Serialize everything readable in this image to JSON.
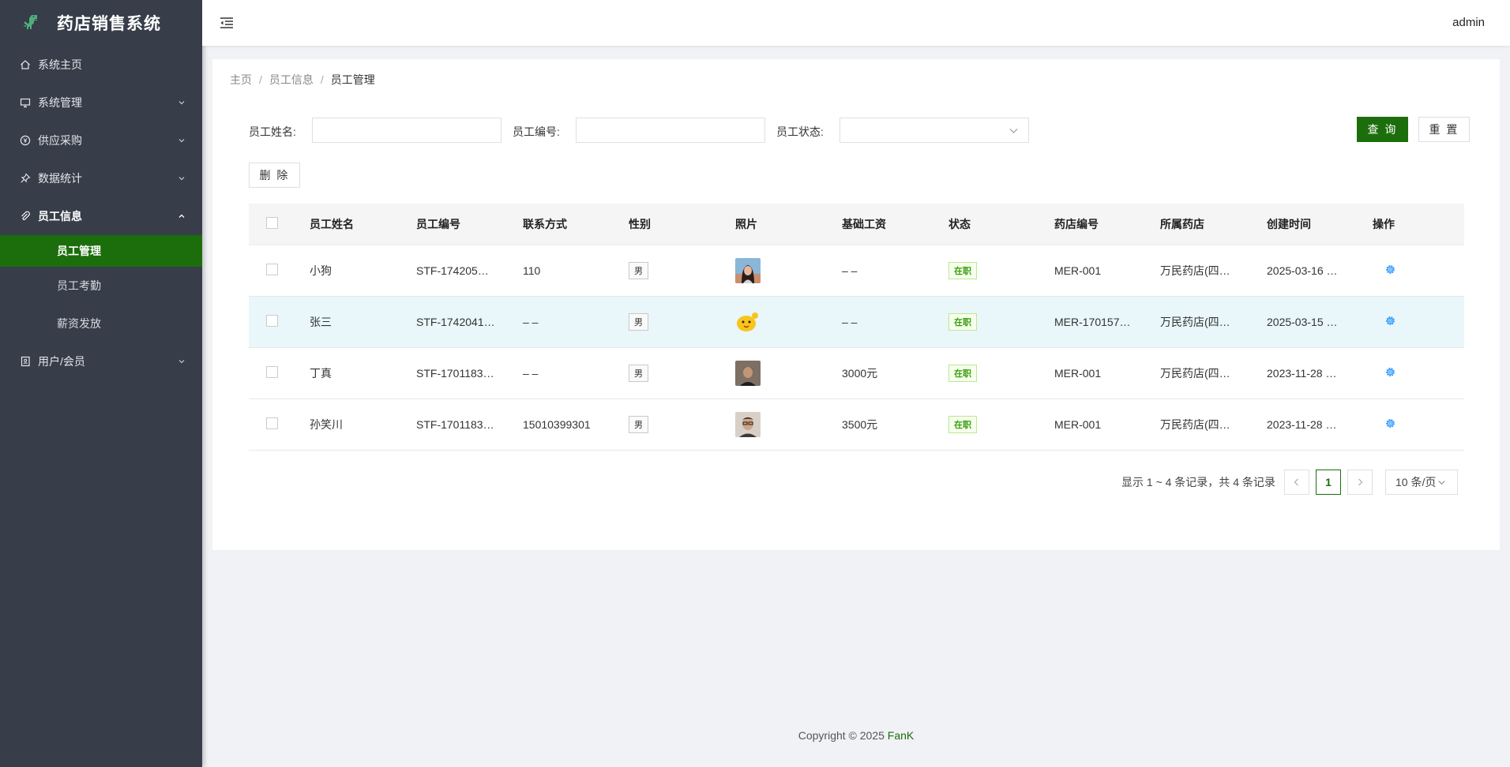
{
  "app": {
    "title": "药店销售系统",
    "user": "admin"
  },
  "sidebar": {
    "items": [
      {
        "label": "系统主页",
        "icon": "home-icon"
      },
      {
        "label": "系统管理",
        "icon": "monitor-icon"
      },
      {
        "label": "供应采购",
        "icon": "yen-circle-icon"
      },
      {
        "label": "数据统计",
        "icon": "pin-icon"
      },
      {
        "label": "员工信息",
        "icon": "paperclip-icon"
      },
      {
        "label": "用户/会员",
        "icon": "contact-book-icon"
      }
    ],
    "sub_items": [
      "员工管理",
      "员工考勤",
      "薪资发放"
    ]
  },
  "breadcrumb": [
    "主页",
    "员工信息",
    "员工管理"
  ],
  "breadcrumb_sep": "/",
  "filters": {
    "name_label": "员工姓名:",
    "no_label": "员工编号:",
    "status_label": "员工状态:",
    "query_button": "查 询",
    "reset_button": "重 置",
    "delete_button": "删 除"
  },
  "table": {
    "headers": [
      "员工姓名",
      "员工编号",
      "联系方式",
      "性别",
      "照片",
      "基础工资",
      "状态",
      "药店编号",
      "所属药店",
      "创建时间",
      "操作"
    ],
    "rows": [
      {
        "name": "小狗",
        "no": "STF-174205…",
        "contact": "110",
        "gender": "男",
        "salary": "– –",
        "status": "在职",
        "pharm": "MER-001",
        "store": "万民药店(四…",
        "created": "2025-03-16 …"
      },
      {
        "name": "张三",
        "no": "STF-1742041…",
        "contact": "– –",
        "gender": "男",
        "salary": "– –",
        "status": "在职",
        "pharm": "MER-170157…",
        "store": "万民药店(四…",
        "created": "2025-03-15 …"
      },
      {
        "name": "丁真",
        "no": "STF-1701183…",
        "contact": "– –",
        "gender": "男",
        "salary": "3000元",
        "status": "在职",
        "pharm": "MER-001",
        "store": "万民药店(四…",
        "created": "2023-11-28 …"
      },
      {
        "name": "孙笑川",
        "no": "STF-1701183…",
        "contact": "15010399301",
        "gender": "男",
        "salary": "3500元",
        "status": "在职",
        "pharm": "MER-001",
        "store": "万民药店(四…",
        "created": "2023-11-28 …"
      }
    ]
  },
  "pagination": {
    "info": "显示 1 ~ 4 条记录，共 4 条记录",
    "current_page": "1",
    "page_size": "10 条/页"
  },
  "footer": {
    "text": "Copyright © 2025 ",
    "brand": "FanK"
  },
  "colors": {
    "sidebar_bg": "#373d49",
    "accent": "#1c6e0c",
    "status_green": "#389e0d",
    "gear_blue": "#1890ff"
  }
}
